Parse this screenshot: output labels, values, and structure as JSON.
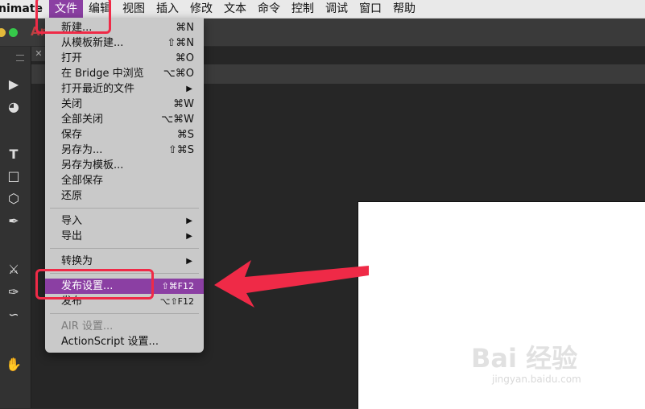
{
  "menubar": {
    "app": "nimate",
    "items": [
      "文件",
      "编辑",
      "视图",
      "插入",
      "修改",
      "文本",
      "命令",
      "控制",
      "调试",
      "窗口",
      "帮助"
    ]
  },
  "window": {
    "app_icon_text": "An"
  },
  "file_menu": {
    "items": [
      {
        "label": "新建...",
        "shortcut": "⌘N"
      },
      {
        "label": "从模板新建...",
        "shortcut": "⇧⌘N"
      },
      {
        "label": "打开",
        "shortcut": "⌘O"
      },
      {
        "label": "在 Bridge 中浏览",
        "shortcut": "⌥⌘O"
      },
      {
        "label": "打开最近的文件",
        "shortcut": "▶"
      },
      {
        "label": "关闭",
        "shortcut": "⌘W"
      },
      {
        "label": "全部关闭",
        "shortcut": "⌥⌘W"
      },
      {
        "label": "保存",
        "shortcut": "⌘S"
      },
      {
        "label": "另存为...",
        "shortcut": "⇧⌘S"
      },
      {
        "label": "另存为模板...",
        "shortcut": ""
      },
      {
        "label": "全部保存",
        "shortcut": ""
      },
      {
        "label": "还原",
        "shortcut": ""
      },
      {
        "label": "导入",
        "shortcut": "▶"
      },
      {
        "label": "导出",
        "shortcut": "▶"
      },
      {
        "label": "转换为",
        "shortcut": "▶"
      },
      {
        "label": "发布设置...",
        "shortcut": "⇧⌘F12"
      },
      {
        "label": "发布",
        "shortcut": "⌥⇧F12"
      },
      {
        "label": "AIR 设置...",
        "shortcut": ""
      },
      {
        "label": "ActionScript 设置...",
        "shortcut": ""
      }
    ]
  },
  "colors": {
    "highlight": "#8b3fa3",
    "annotation": "#ef2a47"
  },
  "watermark": {
    "logo": "Bai 经验",
    "url": "jingyan.baidu.com"
  }
}
